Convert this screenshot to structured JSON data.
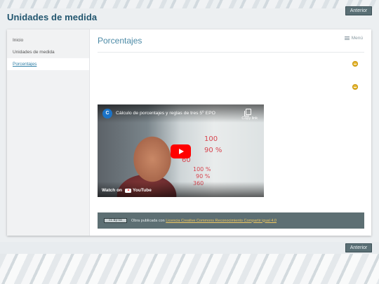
{
  "site": {
    "title": "Unidades de medida"
  },
  "nav": {
    "prev_top": "Anterior",
    "prev_bottom": "Anterior"
  },
  "sidebar": {
    "items": [
      {
        "label": "Inicio",
        "active": false
      },
      {
        "label": "Unidades de medida",
        "active": false
      },
      {
        "label": "Porcentajes",
        "active": true
      }
    ]
  },
  "content": {
    "page_title": "Porcentajes",
    "menu_label": "Menú"
  },
  "video": {
    "channel_initial": "C",
    "title": "Cálculo de porcentajes y reglas de tres 5º EPO",
    "copy_label": "Copy link",
    "watch_on": "Watch on",
    "platform": "YouTube",
    "board_texts": [
      "100",
      "90 %",
      "60",
      "100 %",
      "90 %",
      "360"
    ]
  },
  "license": {
    "badge": "cc by-sa",
    "prefix": "Obra publicada con",
    "link": "Licencia Creative Commons Reconocimiento Compartir igual 4.0"
  },
  "colors": {
    "accent": "#22566f",
    "toggle": "#e4b52f",
    "button": "#5a6f75",
    "license_bar": "#5d6f73"
  }
}
